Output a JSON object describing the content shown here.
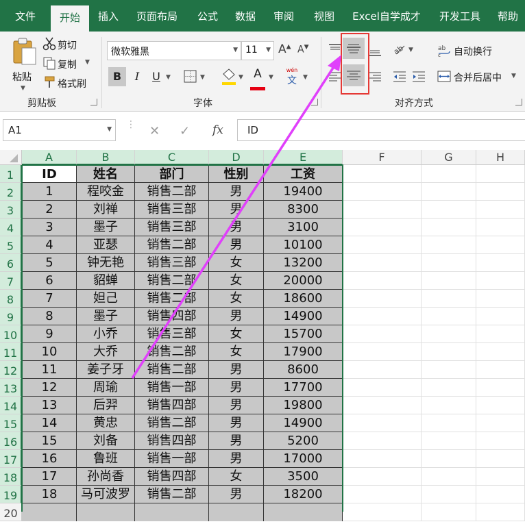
{
  "tabs": [
    "文件",
    "开始",
    "插入",
    "页面布局",
    "公式",
    "数据",
    "审阅",
    "视图",
    "Excel自学成才",
    "开发工具",
    "帮助"
  ],
  "active_tab": "开始",
  "clipboard": {
    "paste": "粘贴",
    "cut": "剪切",
    "copy": "复制",
    "format_painter": "格式刷",
    "group": "剪贴板"
  },
  "font": {
    "name": "微软雅黑",
    "size": "11",
    "bold": "B",
    "italic": "I",
    "underline": "U",
    "color_letter": "A",
    "phonetic_top": "wén",
    "phonetic_char": "文",
    "grow": "A",
    "shrink": "A",
    "group": "字体"
  },
  "alignment": {
    "wrap": "自动换行",
    "merge": "合并后居中",
    "group": "对齐方式"
  },
  "colors": {
    "excel_green": "#217346",
    "highlight_red": "#e53935",
    "arrow_magenta": "#e040fb",
    "font_color_bar": "#e60012",
    "fill_color_bar": "#ffd700"
  },
  "formula_bar": {
    "name_box": "A1",
    "fx": "fx",
    "content": "ID"
  },
  "columns": [
    "A",
    "B",
    "C",
    "D",
    "E",
    "F",
    "G",
    "H"
  ],
  "rows": [
    "1",
    "2",
    "3",
    "4",
    "5",
    "6",
    "7",
    "8",
    "9",
    "10",
    "11",
    "12",
    "13",
    "14",
    "15",
    "16",
    "17",
    "18",
    "19",
    "20"
  ],
  "table": {
    "header": [
      "ID",
      "姓名",
      "部门",
      "性别",
      "工资"
    ],
    "rows": [
      [
        "1",
        "程咬金",
        "销售二部",
        "男",
        "19400"
      ],
      [
        "2",
        "刘禅",
        "销售三部",
        "男",
        "8300"
      ],
      [
        "3",
        "墨子",
        "销售三部",
        "男",
        "3100"
      ],
      [
        "4",
        "亚瑟",
        "销售二部",
        "男",
        "10100"
      ],
      [
        "5",
        "钟无艳",
        "销售三部",
        "女",
        "13200"
      ],
      [
        "6",
        "貂蝉",
        "销售二部",
        "女",
        "20000"
      ],
      [
        "7",
        "妲己",
        "销售二部",
        "女",
        "18600"
      ],
      [
        "8",
        "墨子",
        "销售四部",
        "男",
        "14900"
      ],
      [
        "9",
        "小乔",
        "销售三部",
        "女",
        "15700"
      ],
      [
        "10",
        "大乔",
        "销售二部",
        "女",
        "17900"
      ],
      [
        "11",
        "姜子牙",
        "销售二部",
        "男",
        "8600"
      ],
      [
        "12",
        "周瑜",
        "销售一部",
        "男",
        "17700"
      ],
      [
        "13",
        "后羿",
        "销售四部",
        "男",
        "19800"
      ],
      [
        "14",
        "黄忠",
        "销售二部",
        "男",
        "14900"
      ],
      [
        "15",
        "刘备",
        "销售四部",
        "男",
        "5200"
      ],
      [
        "16",
        "鲁班",
        "销售一部",
        "男",
        "17000"
      ],
      [
        "17",
        "孙尚香",
        "销售四部",
        "女",
        "3500"
      ],
      [
        "18",
        "马可波罗",
        "销售二部",
        "男",
        "18200"
      ]
    ]
  }
}
